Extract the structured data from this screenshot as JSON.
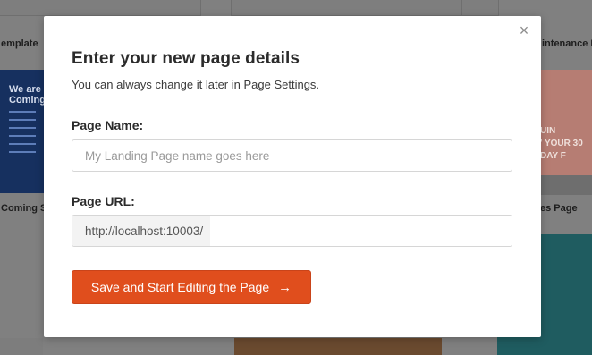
{
  "background": {
    "labels": {
      "template_left": "emplate",
      "template_right": "intenance M",
      "coming_soon": "Coming So",
      "sales_page": "es Page"
    },
    "blue_thumb_text": "We are\nComing",
    "pink_thumb_text": "UIN\n' YOUR 30 DAY F"
  },
  "modal": {
    "close_icon": "×",
    "title": "Enter your new page details",
    "subtitle": "You can always change it later in Page Settings.",
    "page_name": {
      "label": "Page Name:",
      "placeholder": "My Landing Page name goes here",
      "value": ""
    },
    "page_url": {
      "label": "Page URL:",
      "prefix": "http://localhost:10003/",
      "value": ""
    },
    "save_button": {
      "label": "Save and Start Editing the Page",
      "arrow": "→"
    }
  },
  "colors": {
    "accent": "#e04e1d",
    "overlay": "#808080"
  }
}
